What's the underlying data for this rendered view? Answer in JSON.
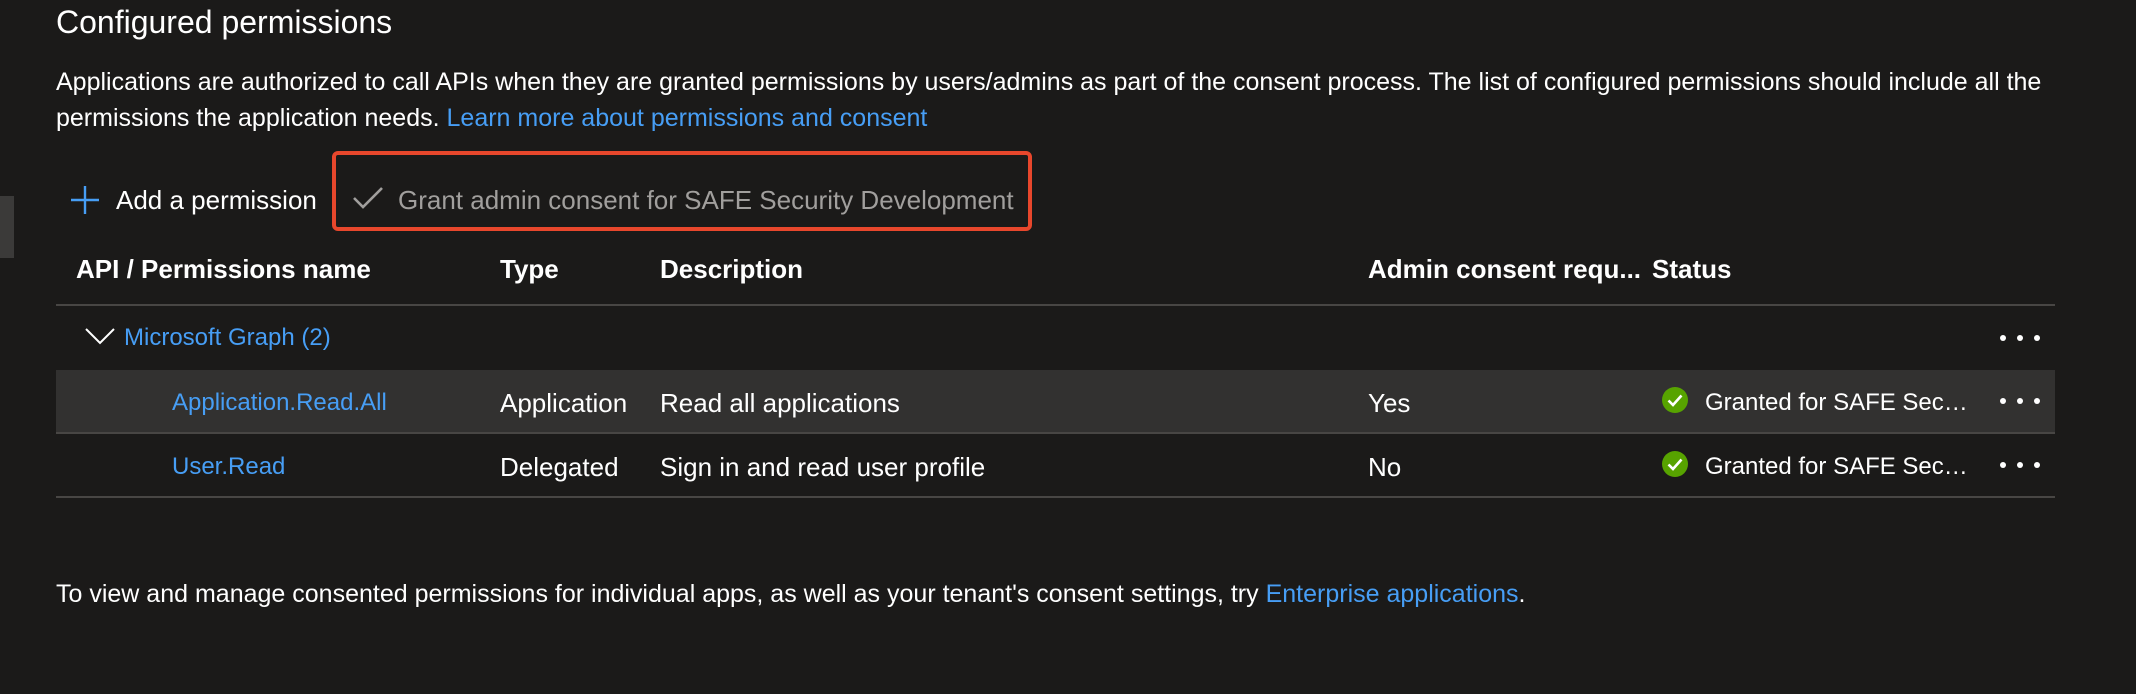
{
  "section": {
    "title": "Configured permissions",
    "description": "Applications are authorized to call APIs when they are granted permissions by users/admins as part of the consent process. The list of configured permissions should include all the permissions the application needs.",
    "learn_more_link": "Learn more about permissions and consent"
  },
  "toolbar": {
    "add_permission_label": "Add a permission",
    "grant_consent_label": "Grant admin consent for SAFE Security Development",
    "grant_consent_disabled": true,
    "highlight_color": "#e8472c"
  },
  "table": {
    "headers": {
      "api_name": "API / Permissions name",
      "type": "Type",
      "description": "Description",
      "admin_consent": "Admin consent requ...",
      "status": "Status"
    },
    "group": {
      "label": "Microsoft Graph (2)",
      "expanded": true
    },
    "rows": [
      {
        "name": "Application.Read.All",
        "type": "Application",
        "description": "Read all applications",
        "admin_consent": "Yes",
        "status": "Granted for SAFE Security Development",
        "status_icon": "check-circle-icon",
        "highlighted": true
      },
      {
        "name": "User.Read",
        "type": "Delegated",
        "description": "Sign in and read user profile",
        "admin_consent": "No",
        "status": "Granted for SAFE Security Development",
        "status_icon": "check-circle-icon",
        "highlighted": false
      }
    ]
  },
  "footer": {
    "text": "To view and manage consented permissions for individual apps, as well as your tenant's consent settings, try",
    "link": "Enterprise applications",
    "trailing": "."
  },
  "colors": {
    "background": "#1b1a19",
    "link": "#479ef5",
    "success": "#57a300",
    "row_highlight": "#323130",
    "divider": "#484644"
  }
}
